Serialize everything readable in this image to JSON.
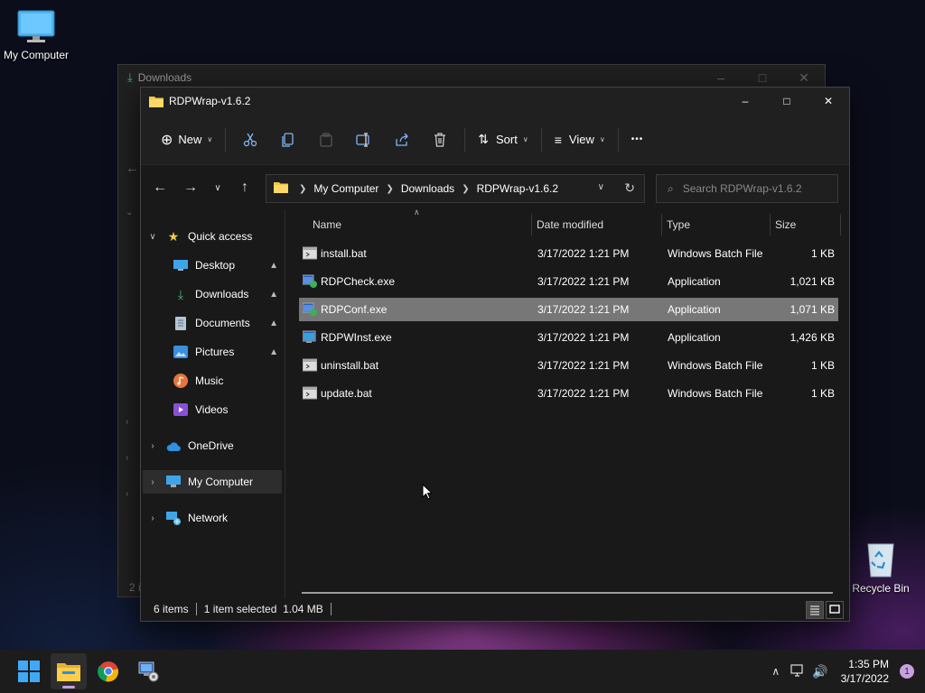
{
  "desktop": {
    "my_computer_label": "My Computer",
    "recycle_bin_label": "Recycle Bin"
  },
  "back_window": {
    "title": "Downloads",
    "status_fragment": "2 i"
  },
  "window": {
    "title": "RDPWrap-v1.6.2",
    "toolbar": {
      "new_label": "New",
      "sort_label": "Sort",
      "view_label": "View",
      "more_label": "•••"
    },
    "address": {
      "segments": [
        "My Computer",
        "Downloads",
        "RDPWrap-v1.6.2"
      ]
    },
    "search": {
      "placeholder": "Search RDPWrap-v1.6.2"
    },
    "sidebar": {
      "quick_access": "Quick access",
      "items": [
        {
          "label": "Desktop",
          "icon": "desktop-icon"
        },
        {
          "label": "Downloads",
          "icon": "download-icon"
        },
        {
          "label": "Documents",
          "icon": "document-icon"
        },
        {
          "label": "Pictures",
          "icon": "picture-icon"
        },
        {
          "label": "Music",
          "icon": "music-icon"
        },
        {
          "label": "Videos",
          "icon": "video-icon"
        }
      ],
      "onedrive": "OneDrive",
      "my_computer": "My Computer",
      "network": "Network"
    },
    "columns": {
      "name": "Name",
      "date": "Date modified",
      "type": "Type",
      "size": "Size"
    },
    "files": [
      {
        "name": "install.bat",
        "date": "3/17/2022 1:21 PM",
        "type": "Windows Batch File",
        "size": "1 KB",
        "kind": "bat"
      },
      {
        "name": "RDPCheck.exe",
        "date": "3/17/2022 1:21 PM",
        "type": "Application",
        "size": "1,021 KB",
        "kind": "exe"
      },
      {
        "name": "RDPConf.exe",
        "date": "3/17/2022 1:21 PM",
        "type": "Application",
        "size": "1,071 KB",
        "kind": "exe"
      },
      {
        "name": "RDPWInst.exe",
        "date": "3/17/2022 1:21 PM",
        "type": "Application",
        "size": "1,426 KB",
        "kind": "exe"
      },
      {
        "name": "uninstall.bat",
        "date": "3/17/2022 1:21 PM",
        "type": "Windows Batch File",
        "size": "1 KB",
        "kind": "bat"
      },
      {
        "name": "update.bat",
        "date": "3/17/2022 1:21 PM",
        "type": "Windows Batch File",
        "size": "1 KB",
        "kind": "bat"
      }
    ],
    "selected_file": "RDPConf.exe",
    "status": {
      "count": "6 items",
      "selection": "1 item selected  1.04 MB"
    }
  },
  "taskbar": {
    "time": "1:35 PM",
    "date": "3/17/2022",
    "notification_count": "1"
  },
  "colors": {
    "accent": "#c9a0e0",
    "window_bg": "#191919",
    "selected_row": "#777777"
  }
}
